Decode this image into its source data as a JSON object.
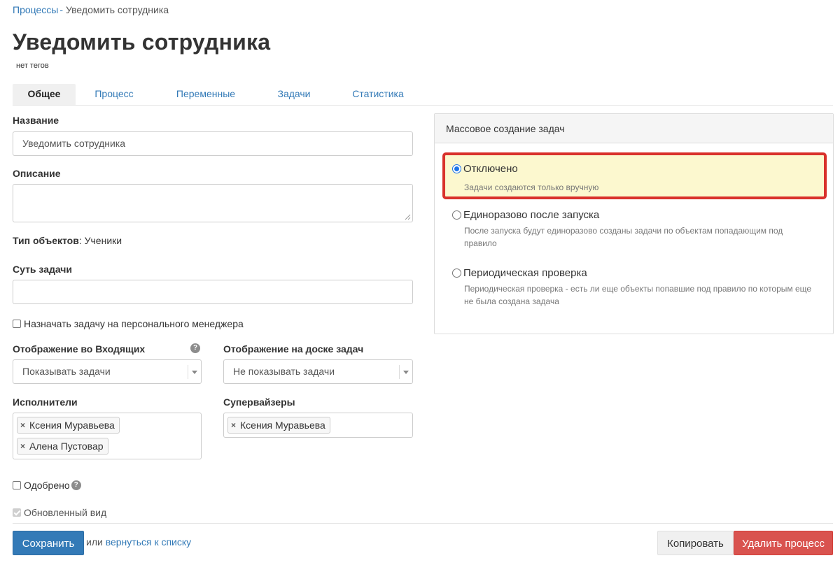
{
  "breadcrumb": {
    "parent": "Процессы",
    "separator": "-",
    "current": "Уведомить сотрудника"
  },
  "title": "Уведомить сотрудника",
  "tags_text": "нет тегов",
  "tabs": [
    {
      "label": "Общее",
      "active": true
    },
    {
      "label": "Процесс",
      "active": false
    },
    {
      "label": "Переменные",
      "active": false
    },
    {
      "label": "Задачи",
      "active": false
    },
    {
      "label": "Статистика",
      "active": false
    }
  ],
  "form": {
    "name_label": "Название",
    "name_value": "Уведомить сотрудника",
    "description_label": "Описание",
    "description_value": "",
    "object_type_label": "Тип объектов",
    "object_type_value": ": Ученики",
    "task_essence_label": "Суть задачи",
    "task_essence_value": "",
    "assign_personal_manager_label": "Назначать задачу на персонального менеджера",
    "inbox_display_label": "Отображение во Входящих",
    "inbox_display_value": "Показывать задачи",
    "board_display_label": "Отображение на доске задач",
    "board_display_value": "Не показывать задачи",
    "executors_label": "Исполнители",
    "executors": [
      "Ксения Муравьева",
      "Алена Пустовар"
    ],
    "supervisors_label": "Супервайзеры",
    "supervisors": [
      "Ксения Муравьева"
    ],
    "approved_label": "Одобрено",
    "updated_view_label": "Обновленный вид",
    "help_glyph": "?",
    "remove_glyph": "×"
  },
  "mass_creation": {
    "title": "Массовое создание задач",
    "options": [
      {
        "label": "Отключено",
        "description": "Задачи создаются только вручную",
        "selected": true
      },
      {
        "label": "Единоразово после запуска",
        "description": "После запуска будут единоразово созданы задачи по объектам попадающим под правило",
        "selected": false
      },
      {
        "label": "Периодическая проверка",
        "description": "Периодическая проверка - есть ли еще объекты попавшие под правило по которым еще не была создана задача",
        "selected": false
      }
    ]
  },
  "footer": {
    "save_label": "Сохранить",
    "or_text": "или",
    "back_link": "вернуться к списку",
    "copy_label": "Копировать",
    "delete_label": "Удалить процесс"
  },
  "colors": {
    "primary": "#337ab7",
    "danger": "#d9534f",
    "highlight_border": "#d9312b",
    "highlight_fill": "#fcf8cf"
  }
}
